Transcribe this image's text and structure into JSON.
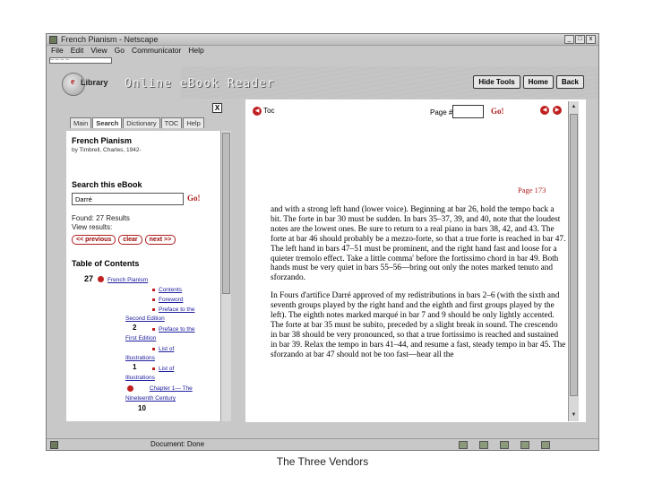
{
  "window": {
    "title": "French Pianism - Netscape",
    "controls": [
      "_",
      "□",
      "x"
    ]
  },
  "menu": [
    "File",
    "Edit",
    "View",
    "Go",
    "Communicator",
    "Help"
  ],
  "address_strip": "-- -- -- --",
  "header": {
    "logo_mark": "e",
    "logo_text": "Library",
    "title": "Online eBook Reader",
    "buttons": [
      "Hide Tools",
      "Home",
      "Back"
    ]
  },
  "sidebar": {
    "close": "X",
    "tabs": [
      "Main",
      "Search",
      "Dictionary",
      "TOC",
      "Help"
    ],
    "active_tab": "Search",
    "book_title": "French Pianism",
    "book_author": "by Timbrell, Charles, 1942-",
    "search_heading": "Search this eBook",
    "search_value": "Darré",
    "go_label": "Go!",
    "found": "Found: 27 Results",
    "view": "View results:",
    "nav_buttons": [
      "<< previous",
      "clear",
      "next >>"
    ],
    "toc_heading": "Table of Contents",
    "toc_top_count": "27",
    "toc_top_link": "French Pianism",
    "toc_entries": [
      {
        "count": "",
        "lines": [
          "Contents"
        ]
      },
      {
        "count": "",
        "lines": [
          "Foreword"
        ]
      },
      {
        "count": "",
        "lines": [
          "Preface to the",
          "Second Edition"
        ]
      },
      {
        "count": "2",
        "lines": [
          "Preface to the",
          "First Edition"
        ]
      },
      {
        "count": "",
        "lines": [
          "List of",
          "Illustrations"
        ]
      },
      {
        "count": "1",
        "lines": [
          "List of",
          "Illustrations"
        ]
      },
      {
        "count": "",
        "lines": [
          "Chapter 1— The",
          "Nineteenth Century"
        ]
      }
    ],
    "toc_bottom_count": "10"
  },
  "reader": {
    "prev_label": "Toc",
    "page_label": "Page #",
    "go_label": "Go!",
    "page_number": "Page 173",
    "paragraphs": [
      "and with a strong left hand (lower voice). Beginning at bar 26, hold the tempo back a bit. The forte in bar 30 must be sudden. In bars 35–37, 39, and 40, note that the loudest notes are the lowest ones. Be sure to return to a real piano in bars 38, 42, and 43. The forte at bar 46 should probably be a mezzo-forte, so that a true forte is reached in bar 47. The left hand in bars 47–51 must be prominent, and the right hand fast and loose for a quieter tremolo effect. Take a little comma' before the fortissimo chord in bar 49. Both hands must be very quiet in bars 55–56—bring out only the notes marked tenuto and sforzando.",
      "In Fours d'artifice Darré approved of my redistributions in bars 2–6 (with the sixth and seventh groups played by the right hand and the eighth and first groups played by the left). The eighth notes marked marqué in bar 7 and 9 should be only lightly accented. The forte at bar 35 must be subito, preceded by a slight break in sound. The crescendo in bar 38 should be very pronounced, so that a true fortissimo is reached and sustained in bar 39. Relax the tempo in bars 41–44, and resume a fast, steady tempo in bar 45. The sforzando at bar 47 should not be too fast—hear all the"
    ]
  },
  "status": {
    "text": "Document: Done"
  },
  "caption": "The Three Vendors"
}
